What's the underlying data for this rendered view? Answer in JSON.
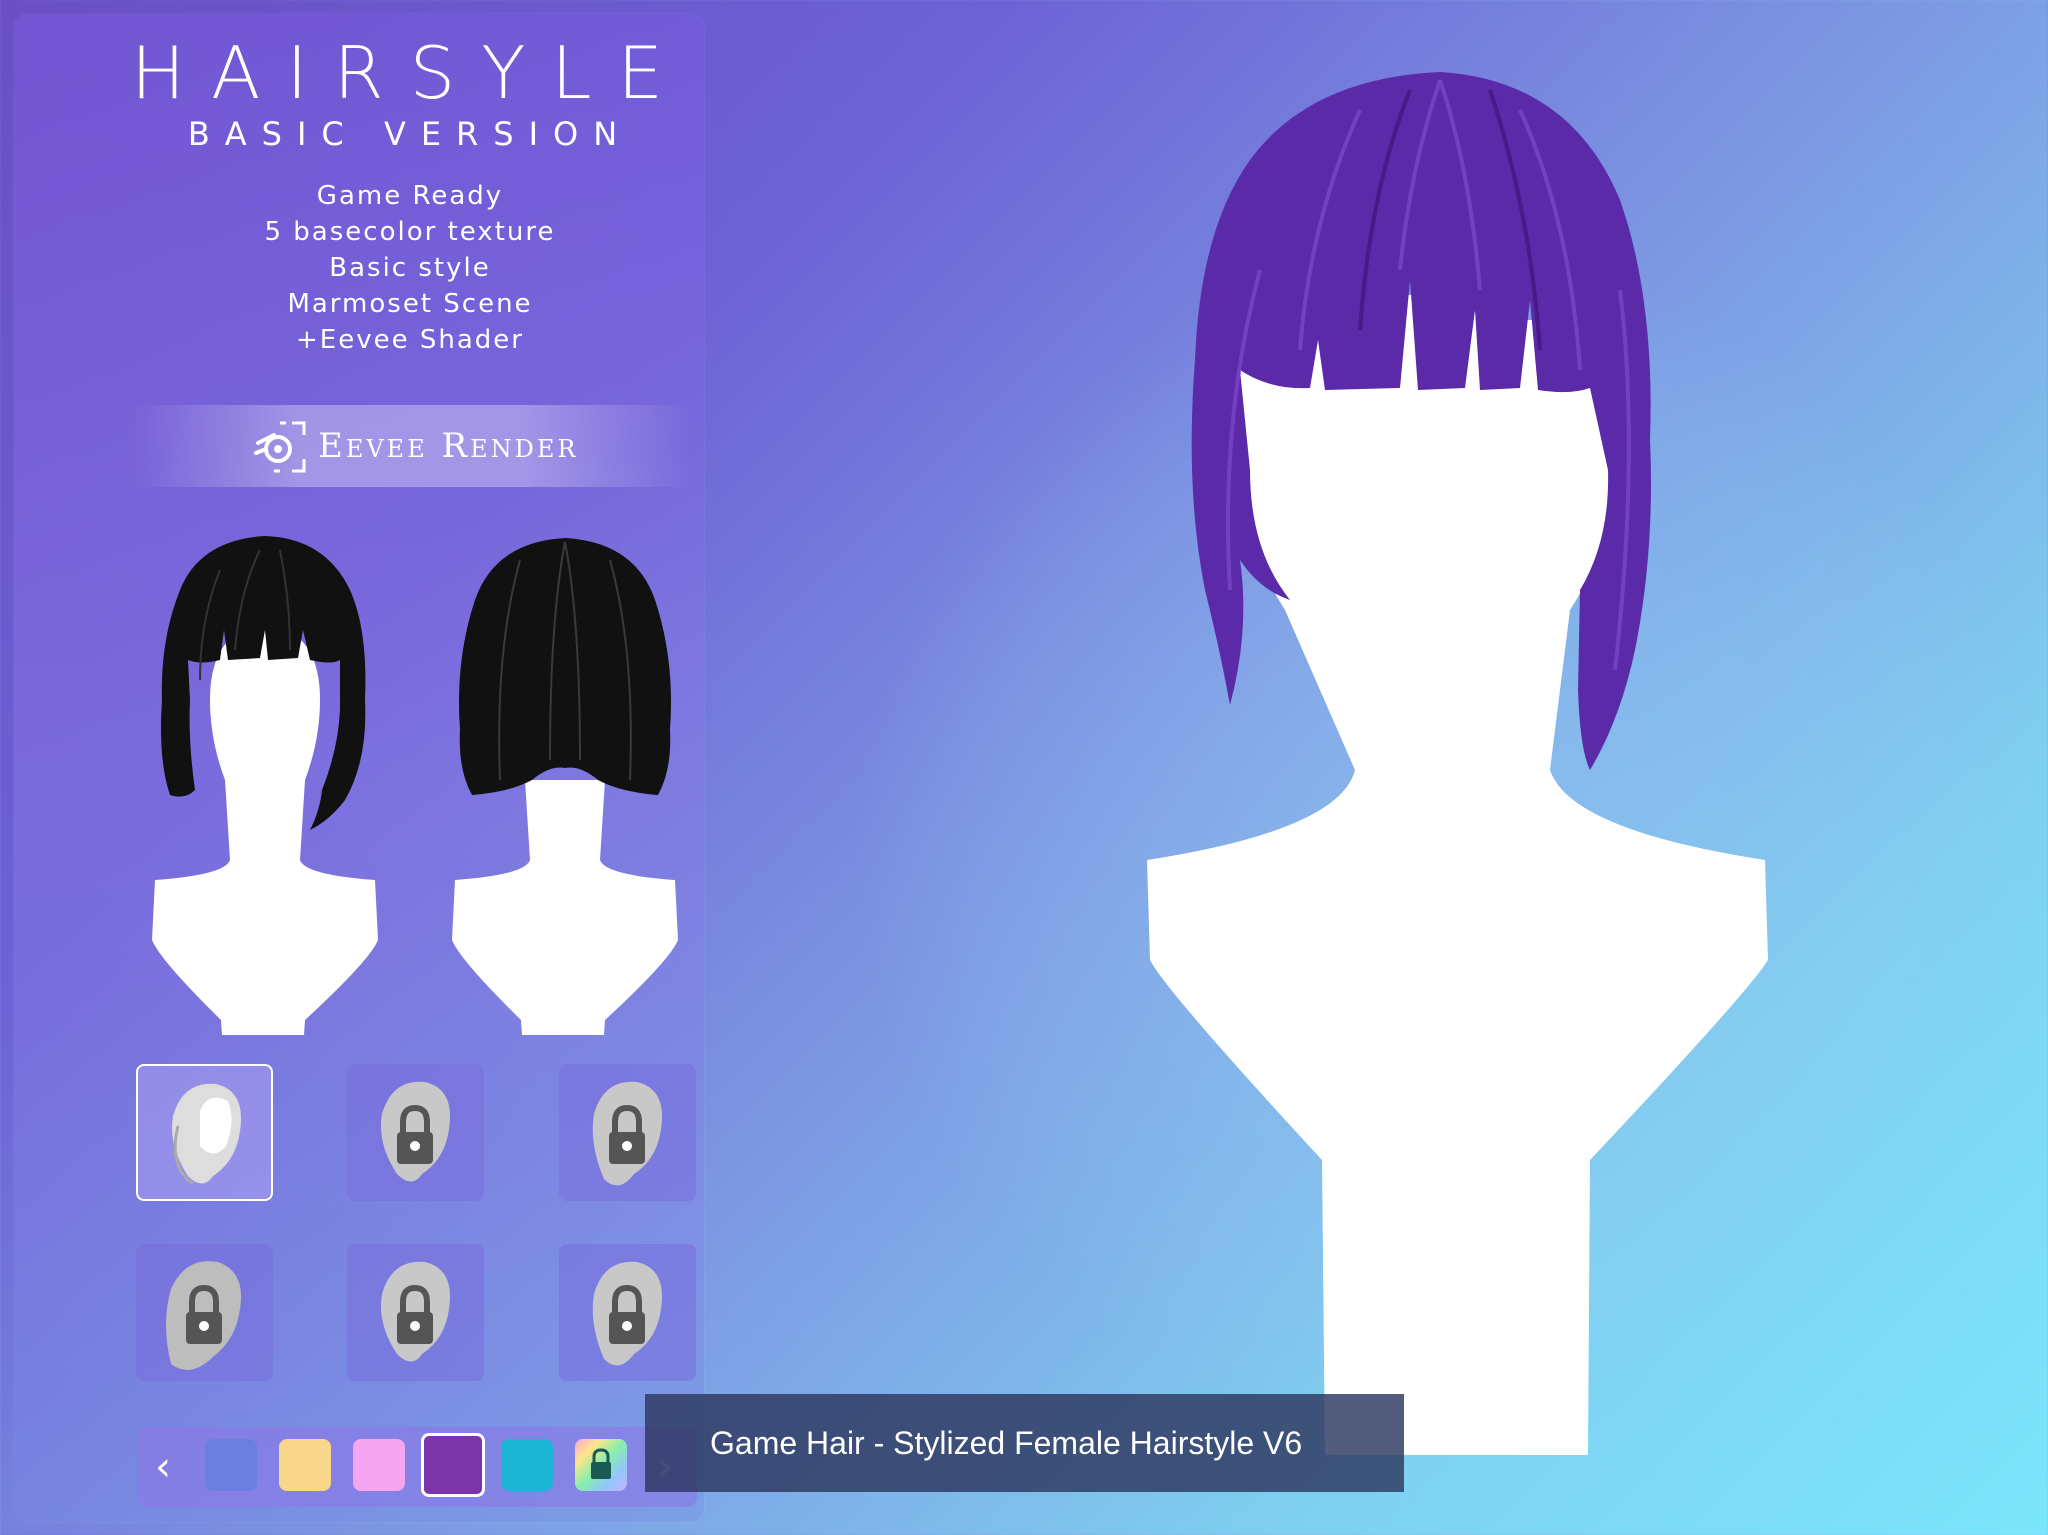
{
  "header": {
    "title": "HAIRSYLE",
    "subtitle": "BASIC VERSION"
  },
  "features": [
    "Game Ready",
    "5 basecolor texture",
    "Basic style",
    "Marmoset Scene",
    "+Eevee Shader"
  ],
  "render_banner": {
    "label": "Eevee Render",
    "icon": "blender-eevee-icon"
  },
  "previews": [
    {
      "view": "front",
      "hair_color": "#111111"
    },
    {
      "view": "back",
      "hair_color": "#111111"
    }
  ],
  "main_preview": {
    "view": "front",
    "hair_color": "#5a2aa8"
  },
  "style_thumbnails": [
    {
      "state": "selected",
      "icon": "hair-style-icon"
    },
    {
      "state": "locked",
      "icon": "lock-icon"
    },
    {
      "state": "locked",
      "icon": "lock-icon"
    },
    {
      "state": "locked",
      "icon": "lock-icon"
    },
    {
      "state": "locked",
      "icon": "lock-icon"
    },
    {
      "state": "locked",
      "icon": "lock-icon"
    }
  ],
  "color_swatches": {
    "prev_icon": "chevron-left-icon",
    "next_icon": "chevron-right-icon",
    "items": [
      {
        "color": "#6a7fe0",
        "state": "normal"
      },
      {
        "color": "#f8d78a",
        "state": "normal"
      },
      {
        "color": "#f6a6f0",
        "state": "normal"
      },
      {
        "color": "#7b35a8",
        "state": "selected"
      },
      {
        "color": "#1bb5d6",
        "state": "normal"
      },
      {
        "color": "rainbow",
        "state": "locked"
      }
    ]
  },
  "product_title": "Game Hair - Stylized Female Hairstyle V6"
}
